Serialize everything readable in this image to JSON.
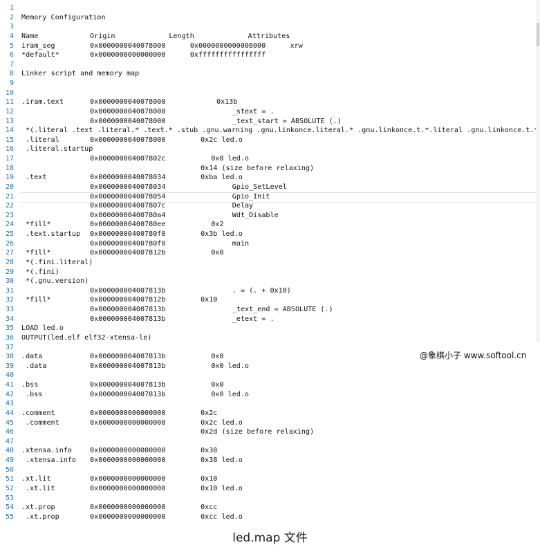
{
  "editor": {
    "line_numbers": [
      "1",
      "2",
      "3",
      "4",
      "5",
      "6",
      "7",
      "8",
      "9",
      "10",
      "11",
      "12",
      "13",
      "14",
      "15",
      "16",
      "17",
      "18",
      "19",
      "20",
      "21",
      "22",
      "23",
      "24",
      "25",
      "26",
      "27",
      "28",
      "29",
      "30",
      "31",
      "32",
      "33",
      "34",
      "35",
      "36",
      "37",
      "38",
      "39",
      "40",
      "41",
      "42",
      "43",
      "44",
      "45",
      "46",
      "47",
      "48",
      "49",
      "50",
      "51",
      "52",
      "53",
      "54",
      "55"
    ],
    "current_line": 21,
    "lines": [
      [],
      [
        {
          "c": 0,
          "t": "Memory Configuration"
        }
      ],
      [],
      [
        {
          "c": 0,
          "t": "Name"
        },
        {
          "c": 13,
          "t": "Origin"
        },
        {
          "c": 28,
          "t": "Length"
        },
        {
          "c": 43,
          "t": "Attributes"
        }
      ],
      [
        {
          "c": 0,
          "t": "iram_seg"
        },
        {
          "c": 13,
          "t": "0x0000000040078000"
        },
        {
          "c": 32,
          "t": "0x0000000000008000"
        },
        {
          "c": 51,
          "t": "xrw"
        }
      ],
      [
        {
          "c": 0,
          "t": "*default*"
        },
        {
          "c": 13,
          "t": "0x0000000000000000"
        },
        {
          "c": 32,
          "t": "0xffffffffffffffff"
        }
      ],
      [],
      [
        {
          "c": 0,
          "t": "Linker script and memory map"
        }
      ],
      [],
      [],
      [
        {
          "c": 0,
          "t": ".iram.text"
        },
        {
          "c": 13,
          "t": "0x0000000040078000"
        },
        {
          "c": 37,
          "t": "0x13b"
        }
      ],
      [
        {
          "c": 13,
          "t": "0x0000000040078000"
        },
        {
          "c": 40,
          "t": "_stext = ."
        }
      ],
      [
        {
          "c": 13,
          "t": "0x0000000040078000"
        },
        {
          "c": 40,
          "t": "_text_start = ABSOLUTE (.)"
        }
      ],
      [
        {
          "c": 0,
          "t": " *(.literal .text .literal.* .text.* .stub .gnu.warning .gnu.linkonce.literal.* .gnu.linkonce.t.*.literal .gnu.linkonce.t.*)"
        }
      ],
      [
        {
          "c": 0,
          "t": " .literal"
        },
        {
          "c": 13,
          "t": "0x0000000040078000"
        },
        {
          "c": 34,
          "t": "0x2c led.o"
        }
      ],
      [
        {
          "c": 0,
          "t": " .literal.startup"
        }
      ],
      [
        {
          "c": 13,
          "t": "0x000000004007802c"
        },
        {
          "c": 36,
          "t": "0x8 led.o"
        }
      ],
      [
        {
          "c": 34,
          "t": "0x14 (size before relaxing)"
        }
      ],
      [
        {
          "c": 0,
          "t": " .text"
        },
        {
          "c": 13,
          "t": "0x0000000040078034"
        },
        {
          "c": 34,
          "t": "0xba led.o"
        }
      ],
      [
        {
          "c": 13,
          "t": "0x0000000040078034"
        },
        {
          "c": 40,
          "t": "Gpio_SetLevel"
        }
      ],
      [
        {
          "c": 13,
          "t": "0x0000000040078054"
        },
        {
          "c": 40,
          "t": "Gpio_Init"
        }
      ],
      [
        {
          "c": 13,
          "t": "0x000000004007807c"
        },
        {
          "c": 40,
          "t": "Delay"
        }
      ],
      [
        {
          "c": 13,
          "t": "0x00000000400780a4"
        },
        {
          "c": 40,
          "t": "Wdt_Disable"
        }
      ],
      [
        {
          "c": 0,
          "t": " *fill*"
        },
        {
          "c": 13,
          "t": "0x00000000400780ee"
        },
        {
          "c": 36,
          "t": "0x2"
        }
      ],
      [
        {
          "c": 0,
          "t": " .text.startup"
        },
        {
          "c": 13,
          "t": "0x00000000400780f0"
        },
        {
          "c": 34,
          "t": "0x3b led.o"
        }
      ],
      [
        {
          "c": 13,
          "t": "0x00000000400780f0"
        },
        {
          "c": 40,
          "t": "main"
        }
      ],
      [
        {
          "c": 0,
          "t": " *fill*"
        },
        {
          "c": 13,
          "t": "0x000000004007812b"
        },
        {
          "c": 36,
          "t": "0x0"
        }
      ],
      [
        {
          "c": 0,
          "t": " *(.fini.literal)"
        }
      ],
      [
        {
          "c": 0,
          "t": " *(.fini)"
        }
      ],
      [
        {
          "c": 0,
          "t": " *(.gnu.version)"
        }
      ],
      [
        {
          "c": 13,
          "t": "0x000000004007813b"
        },
        {
          "c": 40,
          "t": ". = (. + 0x10)"
        }
      ],
      [
        {
          "c": 0,
          "t": " *fill*"
        },
        {
          "c": 13,
          "t": "0x000000004007812b"
        },
        {
          "c": 34,
          "t": "0x10"
        }
      ],
      [
        {
          "c": 13,
          "t": "0x000000004007813b"
        },
        {
          "c": 40,
          "t": "_text_end = ABSOLUTE (.)"
        }
      ],
      [
        {
          "c": 13,
          "t": "0x000000004007813b"
        },
        {
          "c": 40,
          "t": "_etext = ."
        }
      ],
      [
        {
          "c": 0,
          "t": "LOAD led.o"
        }
      ],
      [
        {
          "c": 0,
          "t": "OUTPUT(led.elf elf32-xtensa-le)"
        }
      ],
      [],
      [
        {
          "c": 0,
          "t": ".data"
        },
        {
          "c": 13,
          "t": "0x000000004007813b"
        },
        {
          "c": 36,
          "t": "0x0"
        }
      ],
      [
        {
          "c": 0,
          "t": " .data"
        },
        {
          "c": 13,
          "t": "0x000000004007813b"
        },
        {
          "c": 36,
          "t": "0x0 led.o"
        }
      ],
      [],
      [
        {
          "c": 0,
          "t": ".bss"
        },
        {
          "c": 13,
          "t": "0x000000004007813b"
        },
        {
          "c": 36,
          "t": "0x0"
        }
      ],
      [
        {
          "c": 0,
          "t": " .bss"
        },
        {
          "c": 13,
          "t": "0x000000004007813b"
        },
        {
          "c": 36,
          "t": "0x0 led.o"
        }
      ],
      [],
      [
        {
          "c": 0,
          "t": ".comment"
        },
        {
          "c": 13,
          "t": "0x0000000000000000"
        },
        {
          "c": 34,
          "t": "0x2c"
        }
      ],
      [
        {
          "c": 0,
          "t": " .comment"
        },
        {
          "c": 13,
          "t": "0x0000000000000000"
        },
        {
          "c": 34,
          "t": "0x2c led.o"
        }
      ],
      [
        {
          "c": 34,
          "t": "0x2d (size before relaxing)"
        }
      ],
      [],
      [
        {
          "c": 0,
          "t": ".xtensa.info"
        },
        {
          "c": 13,
          "t": "0x0000000000000000"
        },
        {
          "c": 34,
          "t": "0x38"
        }
      ],
      [
        {
          "c": 0,
          "t": " .xtensa.info"
        },
        {
          "c": 13,
          "t": "0x0000000000000000"
        },
        {
          "c": 34,
          "t": "0x38 led.o"
        }
      ],
      [],
      [
        {
          "c": 0,
          "t": ".xt.lit"
        },
        {
          "c": 13,
          "t": "0x0000000000000000"
        },
        {
          "c": 34,
          "t": "0x10"
        }
      ],
      [
        {
          "c": 0,
          "t": " .xt.lit"
        },
        {
          "c": 13,
          "t": "0x0000000000000000"
        },
        {
          "c": 34,
          "t": "0x10 led.o"
        }
      ],
      [],
      [
        {
          "c": 0,
          "t": ".xt.prop"
        },
        {
          "c": 13,
          "t": "0x0000000000000000"
        },
        {
          "c": 34,
          "t": "0xcc"
        }
      ],
      [
        {
          "c": 0,
          "t": " .xt.prop"
        },
        {
          "c": 13,
          "t": "0x0000000000000000"
        },
        {
          "c": 34,
          "t": "0xcc led.o"
        }
      ]
    ]
  },
  "watermark": "@象棋小子 www.softool.cn",
  "caption": "led.map 文件"
}
